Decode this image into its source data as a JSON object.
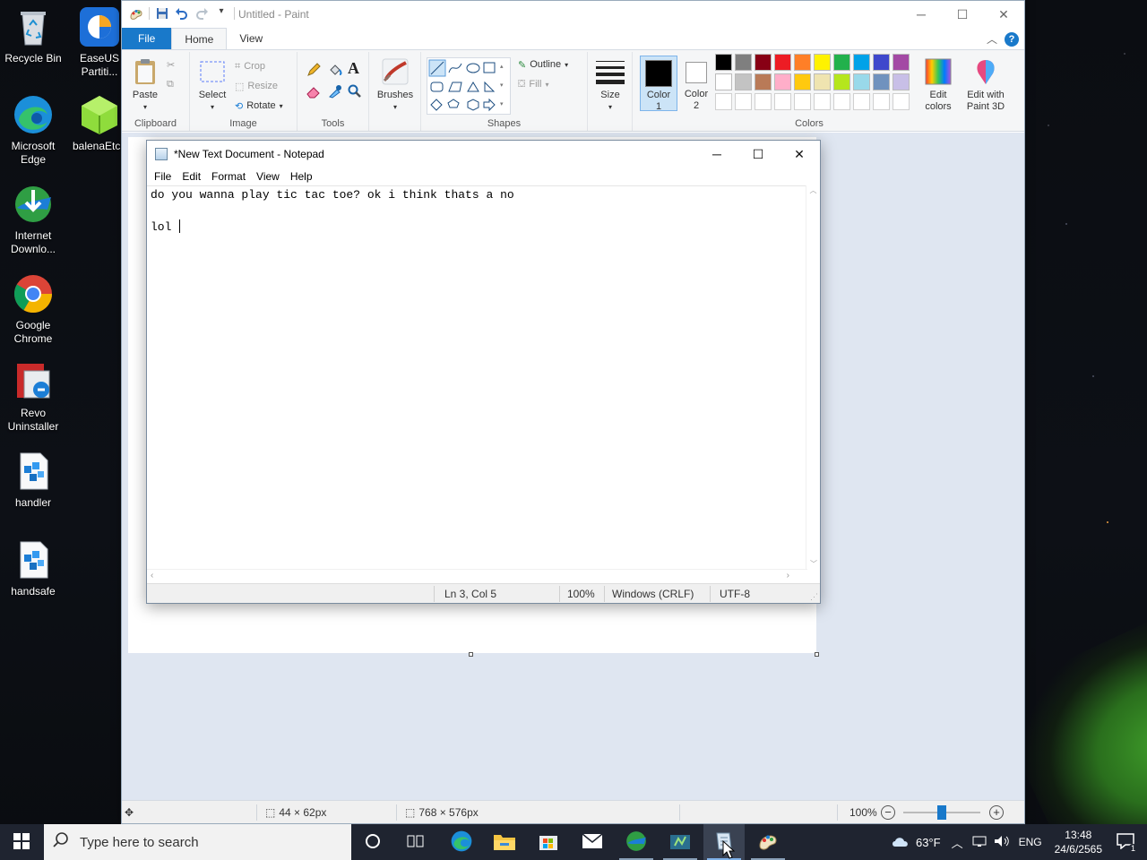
{
  "desktop": {
    "icons": [
      {
        "label": "Recycle Bin"
      },
      {
        "label": "EaseUS Partiti..."
      },
      {
        "label": "Microsoft Edge"
      },
      {
        "label": "balenaEtch"
      },
      {
        "label": "Internet Downlo..."
      },
      {
        "label": "Google Chrome"
      },
      {
        "label": "Revo Uninstaller"
      },
      {
        "label": "handler"
      },
      {
        "label": "handsafe"
      }
    ]
  },
  "paint": {
    "title": "Untitled - Paint",
    "tabs": {
      "file": "File",
      "home": "Home",
      "view": "View"
    },
    "help": "?",
    "clipboard": {
      "paste": "Paste",
      "group": "Clipboard"
    },
    "image": {
      "select": "Select",
      "crop": "Crop",
      "resize": "Resize",
      "rotate": "Rotate",
      "group": "Image"
    },
    "tools": {
      "group": "Tools"
    },
    "brushes": {
      "label": "Brushes"
    },
    "shapes": {
      "outline": "Outline",
      "fill": "Fill",
      "group": "Shapes"
    },
    "size": {
      "label": "Size"
    },
    "colors": {
      "color1": "Color 1",
      "color1_value": "1",
      "color2": "Color 2",
      "color2_value": "2",
      "color1_label": "Color",
      "color2_label": "Color",
      "edit_colors": "Edit colors",
      "edit_paint3d": "Edit with Paint 3D",
      "group": "Colors",
      "palette_row1": [
        "#000000",
        "#7f7f7f",
        "#880015",
        "#ed1c24",
        "#ff7f27",
        "#fff200",
        "#22b14c",
        "#00a2e8",
        "#3f48cc",
        "#a349a4"
      ],
      "palette_row2": [
        "#ffffff",
        "#c3c3c3",
        "#b97a57",
        "#ffaec9",
        "#ffc90e",
        "#efe4b0",
        "#b5e61d",
        "#99d9ea",
        "#7092be",
        "#c8bfe7"
      ]
    },
    "status": {
      "selection": "44 × 62px",
      "canvas": "768 × 576px",
      "zoom": "100%"
    }
  },
  "notepad": {
    "title": "*New Text Document - Notepad",
    "menu": {
      "file": "File",
      "edit": "Edit",
      "format": "Format",
      "view": "View",
      "help": "Help"
    },
    "line1": "do you wanna play tic tac toe? ok i think thats a no",
    "line2": "",
    "line3": "lol ",
    "status": {
      "position": "Ln 3, Col 5",
      "zoom": "100%",
      "eol": "Windows (CRLF)",
      "encoding": "UTF-8"
    }
  },
  "taskbar": {
    "search_placeholder": "Type here to search",
    "weather": "63°F",
    "lang": "ENG",
    "time": "13:48",
    "date": "24/6/2565",
    "notifications": "1"
  }
}
